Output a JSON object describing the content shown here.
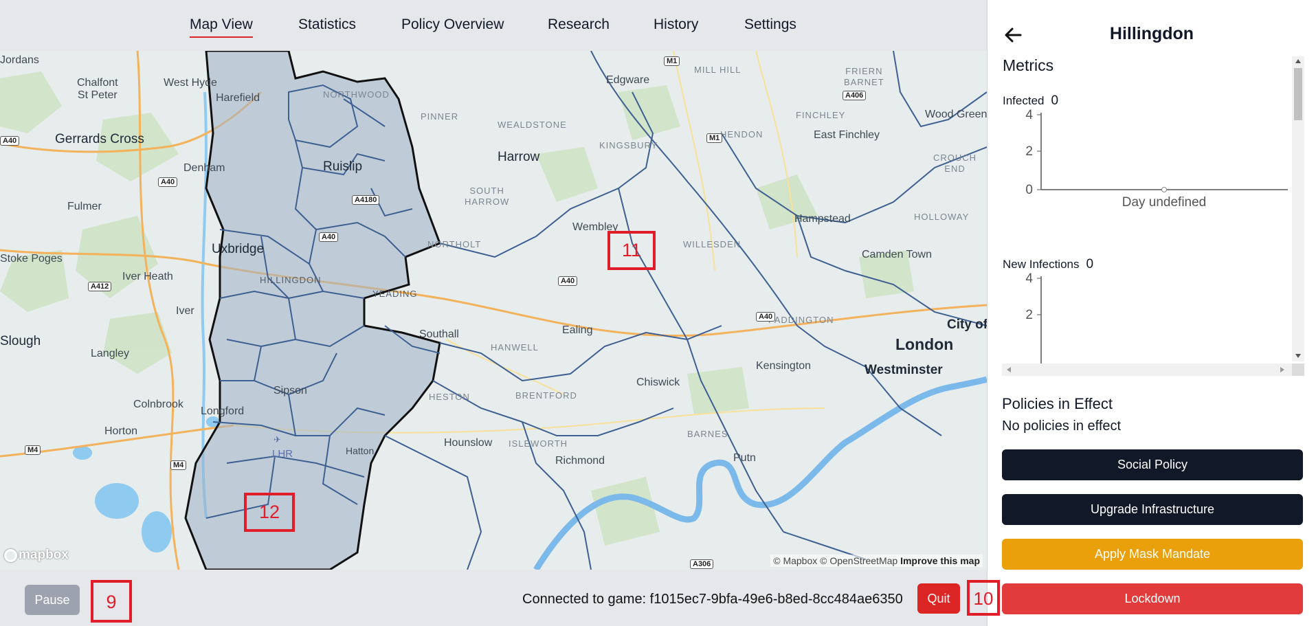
{
  "nav": {
    "tabs": [
      {
        "label": "Map View",
        "active": true
      },
      {
        "label": "Statistics"
      },
      {
        "label": "Policy Overview"
      },
      {
        "label": "Research"
      },
      {
        "label": "History"
      },
      {
        "label": "Settings"
      }
    ]
  },
  "map": {
    "places": {
      "jordans": "Jordans",
      "chalfont": "Chalfont\nSt Peter",
      "west_hyde": "West Hyde",
      "harefield": "Harefield",
      "gerrards_cross": "Gerrards Cross",
      "denham": "Denham",
      "fulmer": "Fulmer",
      "ruislip": "Ruislip",
      "uxbridge": "Uxbridge",
      "stoke_poges": "Stoke Poges",
      "iver_heath": "Iver Heath",
      "iver": "Iver",
      "slough": "Slough",
      "langley": "Langley",
      "colnbrook": "Colnbrook",
      "horton": "Horton",
      "longford": "Longford",
      "sipson": "Sipson",
      "lhr": "LHR",
      "hatton": "Hatton",
      "edgware": "Edgware",
      "harrow": "Harrow",
      "wembley": "Wembley",
      "ealing": "Ealing",
      "southall": "Southall",
      "hounslow": "Hounslow",
      "richmond": "Richmond",
      "chiswick": "Chiswick",
      "kensington": "Kensington",
      "hampstead": "Hampstead",
      "camden_town": "Camden Town",
      "east_finchley": "East Finchley",
      "wood_green": "Wood Green",
      "london": "London",
      "westminster": "Westminster",
      "city_of": "City of",
      "putney": "Putn"
    },
    "districts": {
      "northwood": "NORTHWOOD",
      "pinner": "PINNER",
      "wealdstone": "WEALDSTONE",
      "kingsbury": "KINGSBURY",
      "mill_hill": "MILL HILL",
      "friern_barnet": "FRIERN\nBARNET",
      "finchley": "FINCHLEY",
      "hendon": "HENDON",
      "crouch_end": "CROUCH\nEND",
      "holloway": "HOLLOWAY",
      "south_harrow": "SOUTH\nHARROW",
      "northolt": "NORTHOLT",
      "willesden": "WILLESDEN",
      "hillingdon": "HILLINGDON",
      "yeading": "YEADING",
      "hanwell": "HANWELL",
      "paddington": "PADDINGTON",
      "heston": "HESTON",
      "brentford": "BRENTFORD",
      "isleworth": "ISLEWORTH",
      "barnes": "BARNES"
    },
    "roads": [
      "M1",
      "M1",
      "A406",
      "A40",
      "A4180",
      "A40",
      "A40",
      "A40",
      "A412",
      "M4",
      "M4",
      "A306",
      "A40"
    ],
    "attribution": "© Mapbox © OpenStreetMap",
    "improve": "Improve this map",
    "logo": "mapbox"
  },
  "markers": {
    "m9": "9",
    "m10": "10",
    "m11": "11",
    "m12": "12"
  },
  "footer": {
    "pause": "Pause",
    "connection": "Connected to game: f1015ec7-9bfa-49e6-b8ed-8cc484ae6350",
    "quit": "Quit"
  },
  "panel": {
    "title": "Hillingdon",
    "metrics_title": "Metrics",
    "infected_label": "Infected",
    "infected_value": "0",
    "new_infections_label": "New Infections",
    "new_infections_value": "0",
    "x_axis_label": "Day undefined",
    "y_ticks": [
      "4",
      "2",
      "0"
    ],
    "policies_title": "Policies in Effect",
    "policies_none": "No policies in effect",
    "buttons": {
      "social": "Social Policy",
      "infrastructure": "Upgrade Infrastructure",
      "mask": "Apply Mask Mandate",
      "lockdown": "Lockdown"
    }
  },
  "colors": {
    "accent_red": "#dc2626",
    "dark_button": "#111827",
    "amber_button": "#e9a00a",
    "lockdown_red": "#e23b3b",
    "region_fill": "#9fb3c8",
    "boundary": "#3e5f92"
  }
}
